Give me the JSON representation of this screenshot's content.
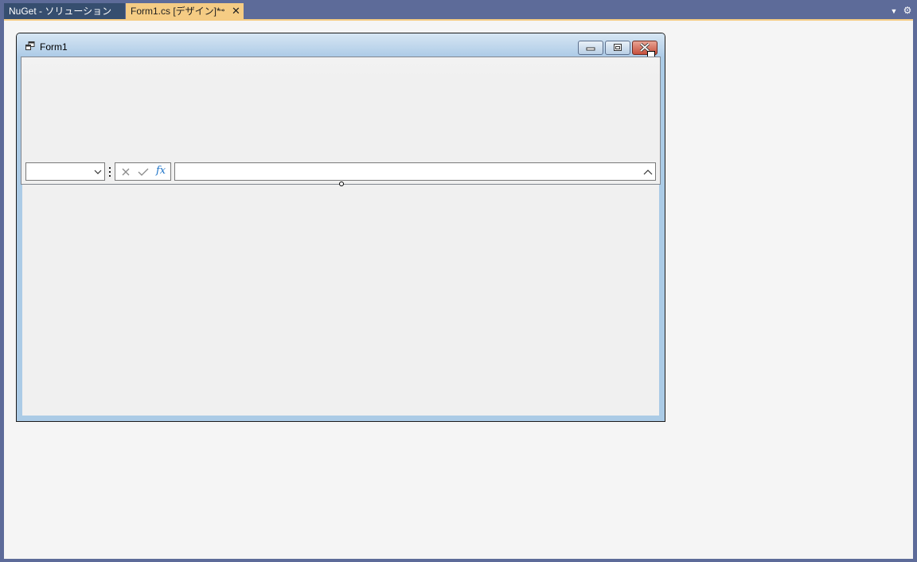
{
  "tabs": [
    {
      "label": "NuGet - ソリューション",
      "active": false
    },
    {
      "label": "Form1.cs [デザイン]*",
      "active": true
    }
  ],
  "form": {
    "title": "Form1"
  },
  "formula_bar": {
    "name_box_value": "",
    "formula_value": "",
    "fx_label": "fx"
  },
  "colors": {
    "chrome": "#5d6b99",
    "active_tab": "#f5cc84",
    "inactive_tab": "#364e6f",
    "designer_bg": "#f5f5f5",
    "form_border": "#abcbe6",
    "fx_blue": "#1e74c8"
  },
  "icons": {
    "tab_pin": "pin-icon",
    "tab_close": "close-icon",
    "strip_dropdown": "dropdown-icon",
    "strip_settings": "gear-icon",
    "form_icon": "form-icon",
    "minimize": "minimize-icon",
    "maximize": "maximize-icon",
    "close": "close-icon",
    "cancel": "cancel-x-icon",
    "confirm": "check-icon",
    "expand": "chevron-up-icon"
  }
}
